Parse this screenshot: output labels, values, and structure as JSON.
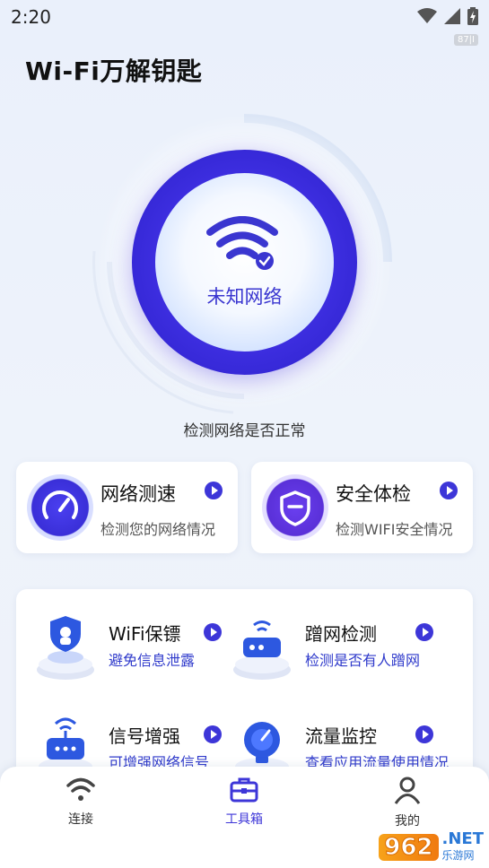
{
  "status": {
    "time": "2:20",
    "badge": "87|I"
  },
  "app": {
    "title": "Wi-Fi万解钥匙"
  },
  "hero": {
    "status_label": "未知网络",
    "subtitle": "检测网络是否正常"
  },
  "quick_actions": [
    {
      "title": "网络测速",
      "desc": "检测您的网络情况"
    },
    {
      "title": "安全体检",
      "desc": "检测WIFI安全情况"
    }
  ],
  "tools": [
    {
      "title": "WiFi保镖",
      "desc": "避免信息泄露"
    },
    {
      "title": "蹭网检测",
      "desc": "检测是否有人蹭网"
    },
    {
      "title": "信号增强",
      "desc": "可增强网络信号"
    },
    {
      "title": "流量监控",
      "desc": "查看应用流量使用情况"
    }
  ],
  "nav": {
    "items": [
      {
        "label": "连接",
        "icon": "wifi-icon"
      },
      {
        "label": "工具箱",
        "icon": "toolbox-icon"
      },
      {
        "label": "我的",
        "icon": "person-icon"
      }
    ],
    "active_index": 1
  },
  "watermark": {
    "num": "962",
    "net": ".NET",
    "sub": "乐游网"
  },
  "colors": {
    "accent": "#3d36d8",
    "accent_dark": "#2a1fc8",
    "bg": "#eaf0fb"
  }
}
